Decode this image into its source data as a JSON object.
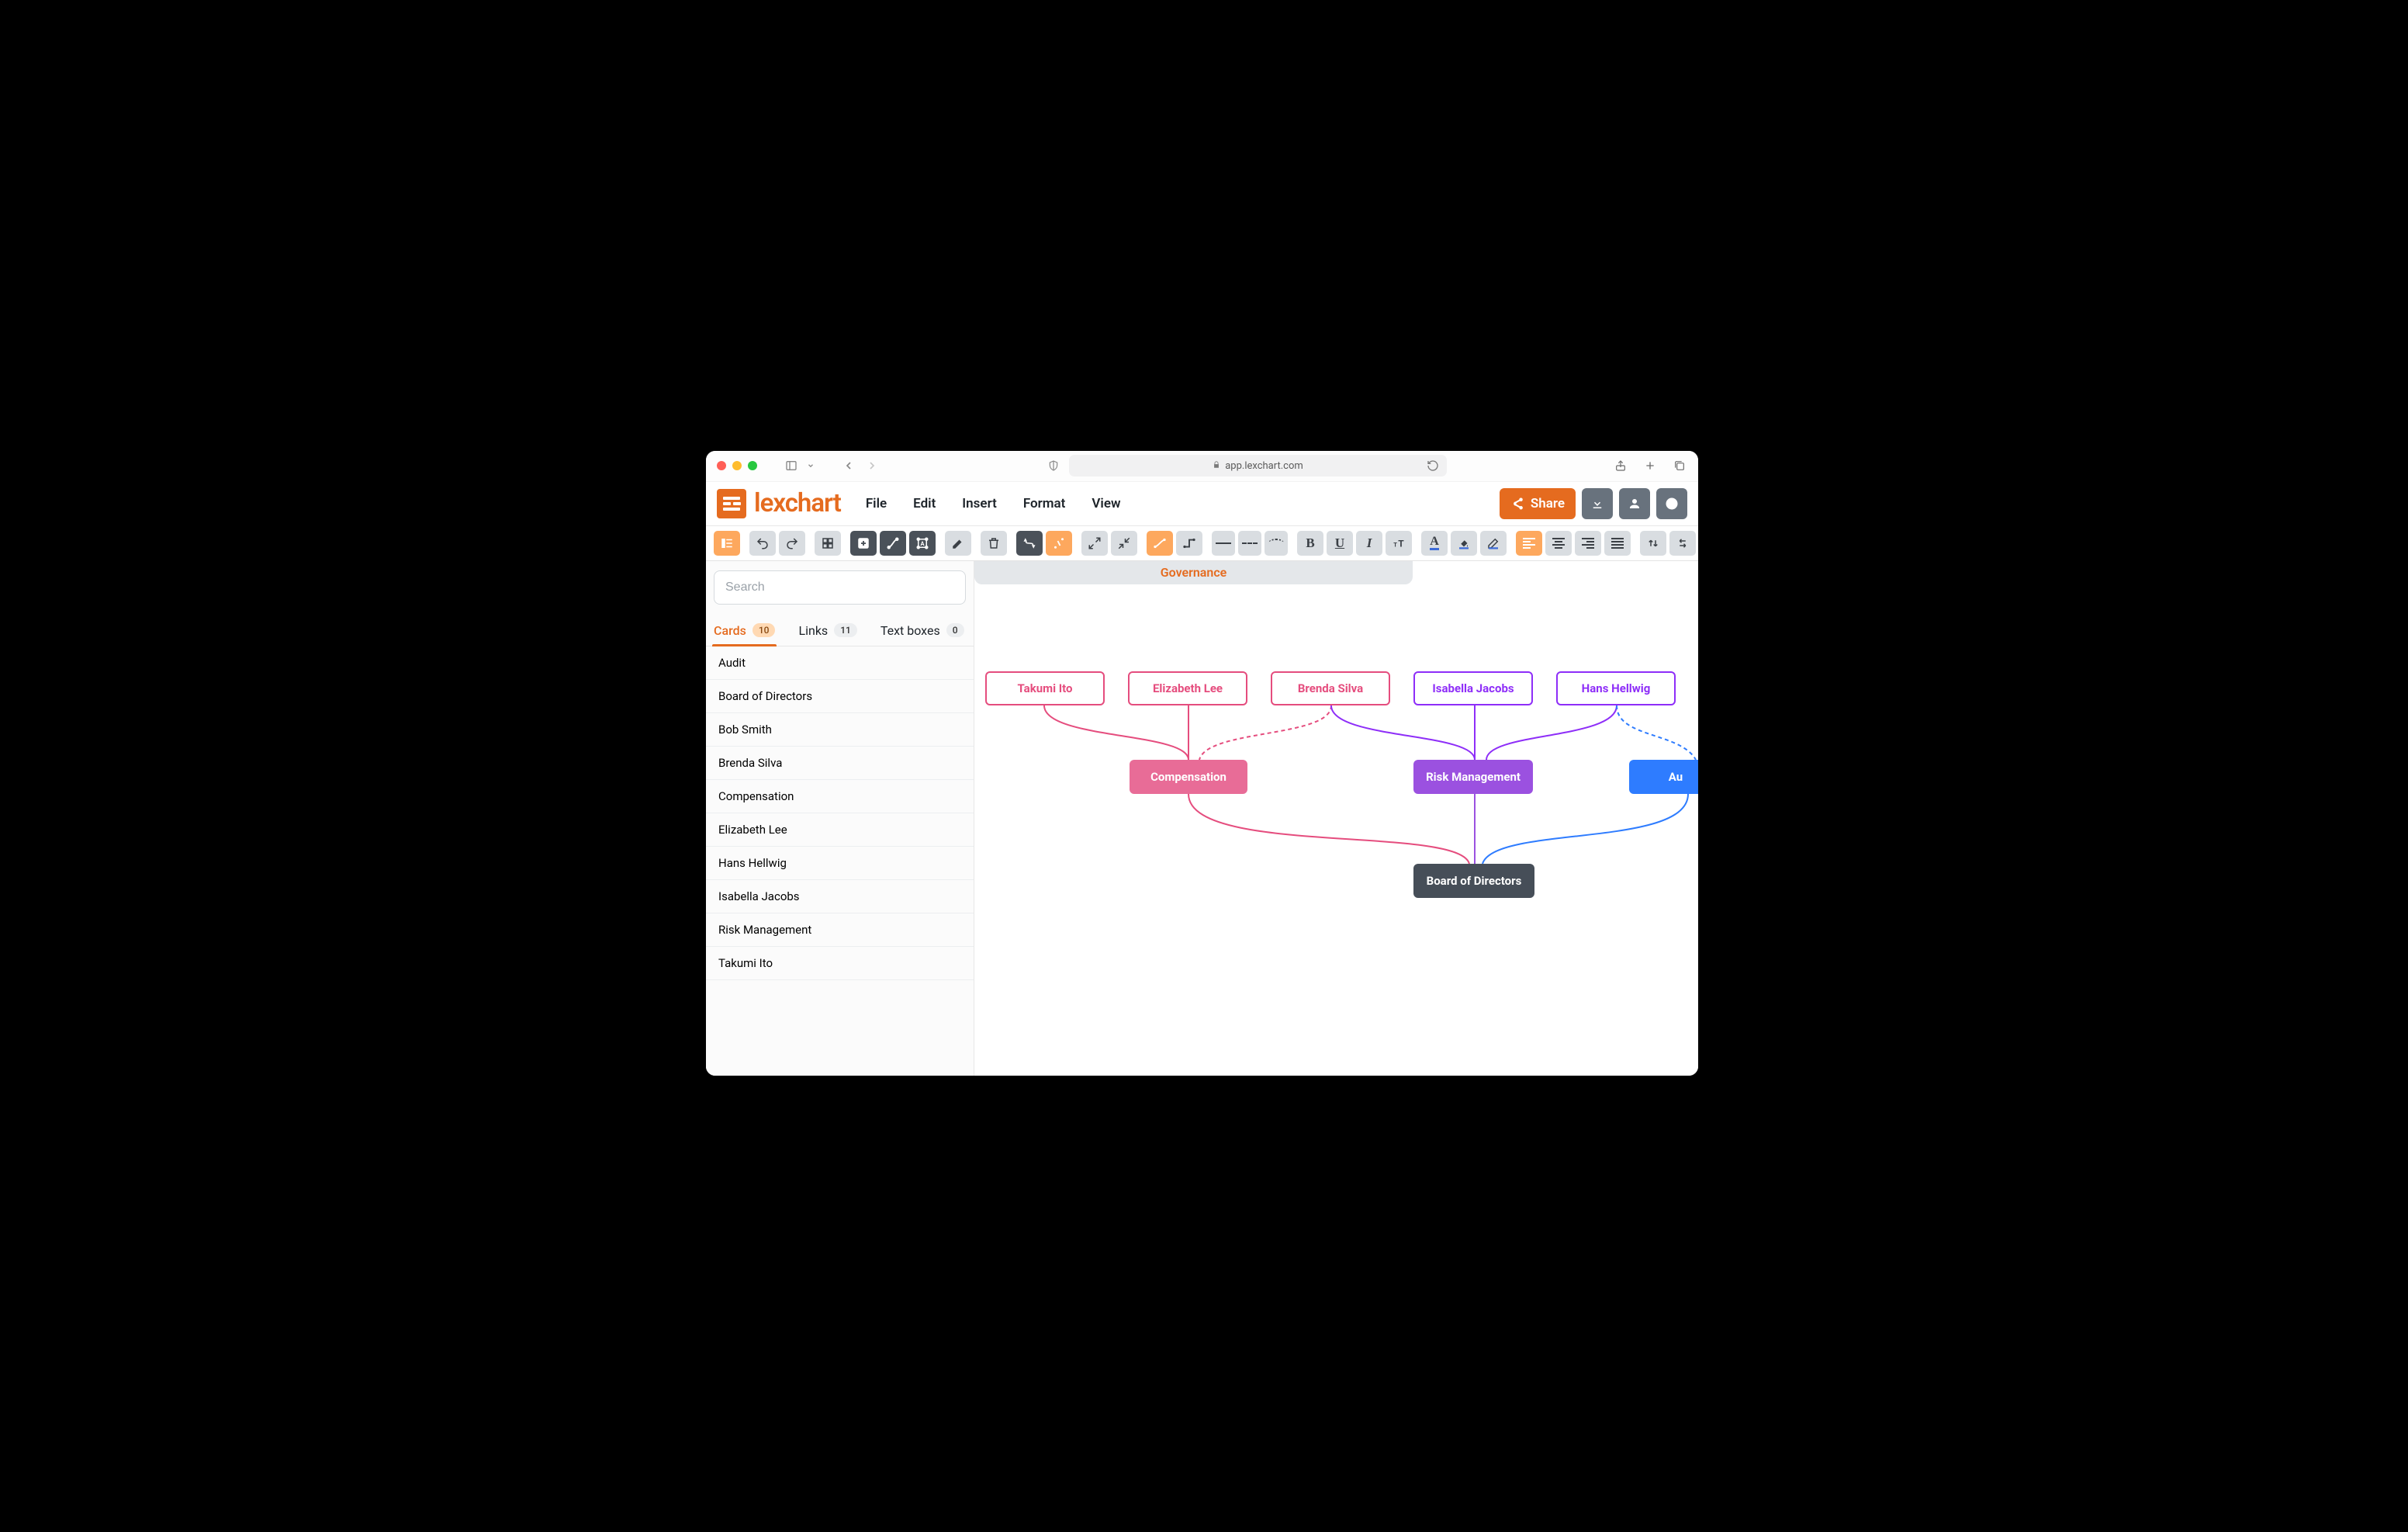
{
  "browser": {
    "url": "app.lexchart.com"
  },
  "app": {
    "logo_text": "lexchart",
    "menus": {
      "file": "File",
      "edit": "Edit",
      "insert": "Insert",
      "format": "Format",
      "view": "View"
    },
    "header_buttons": {
      "share": "Share"
    }
  },
  "sidebar": {
    "search_placeholder": "Search",
    "tabs": {
      "cards": {
        "label": "Cards",
        "count": "10"
      },
      "links": {
        "label": "Links",
        "count": "11"
      },
      "textboxes": {
        "label": "Text boxes",
        "count": "0"
      }
    },
    "items": [
      "Audit",
      "Board of Directors",
      "Bob Smith",
      "Brenda Silva",
      "Compensation",
      "Elizabeth Lee",
      "Hans Hellwig",
      "Isabella Jacobs",
      "Risk Management",
      "Takumi Ito"
    ]
  },
  "canvas": {
    "tab_title": "Governance",
    "nodes": {
      "takumi": "Takumi Ito",
      "elizabeth": "Elizabeth Lee",
      "brenda": "Brenda Silva",
      "isabella": "Isabella Jacobs",
      "hans": "Hans Hellwig",
      "compensation": "Compensation",
      "risk": "Risk Management",
      "audit": "Au",
      "board": "Board of Directors"
    }
  },
  "colors": {
    "orange": "#e56b1f",
    "pink": "#e54d7e",
    "pink_fill": "#e86c97",
    "purple": "#8e2ef8",
    "violet": "#9b51e0",
    "blue": "#2e7cff",
    "dark": "#464e58"
  },
  "chart_data": {
    "type": "diagram",
    "title": "Governance",
    "nodes": [
      {
        "id": "takumi",
        "label": "Takumi Ito",
        "style": "outline-pink",
        "row": 1
      },
      {
        "id": "elizabeth",
        "label": "Elizabeth Lee",
        "style": "outline-pink",
        "row": 1
      },
      {
        "id": "brenda",
        "label": "Brenda Silva",
        "style": "outline-pink",
        "row": 1
      },
      {
        "id": "isabella",
        "label": "Isabella Jacobs",
        "style": "outline-purple",
        "row": 1
      },
      {
        "id": "hans",
        "label": "Hans Hellwig",
        "style": "outline-purple",
        "row": 1
      },
      {
        "id": "compensation",
        "label": "Compensation",
        "style": "fill-pink",
        "row": 2
      },
      {
        "id": "risk",
        "label": "Risk Management",
        "style": "fill-violet",
        "row": 2
      },
      {
        "id": "audit",
        "label": "Audit",
        "style": "fill-blue",
        "row": 2,
        "clipped": true
      },
      {
        "id": "board",
        "label": "Board of Directors",
        "style": "fill-dark",
        "row": 3
      }
    ],
    "links": [
      {
        "from": "takumi",
        "to": "compensation",
        "style": "solid",
        "color": "pink"
      },
      {
        "from": "elizabeth",
        "to": "compensation",
        "style": "solid",
        "color": "pink"
      },
      {
        "from": "brenda",
        "to": "compensation",
        "style": "dashed",
        "color": "pink"
      },
      {
        "from": "brenda",
        "to": "risk",
        "style": "solid",
        "color": "purple"
      },
      {
        "from": "isabella",
        "to": "risk",
        "style": "solid",
        "color": "purple"
      },
      {
        "from": "hans",
        "to": "risk",
        "style": "solid",
        "color": "purple"
      },
      {
        "from": "hans",
        "to": "audit",
        "style": "dashed",
        "color": "blue"
      },
      {
        "from": "compensation",
        "to": "board",
        "style": "solid",
        "color": "pink"
      },
      {
        "from": "risk",
        "to": "board",
        "style": "solid",
        "color": "violet"
      },
      {
        "from": "audit",
        "to": "board",
        "style": "solid",
        "color": "blue"
      }
    ]
  }
}
